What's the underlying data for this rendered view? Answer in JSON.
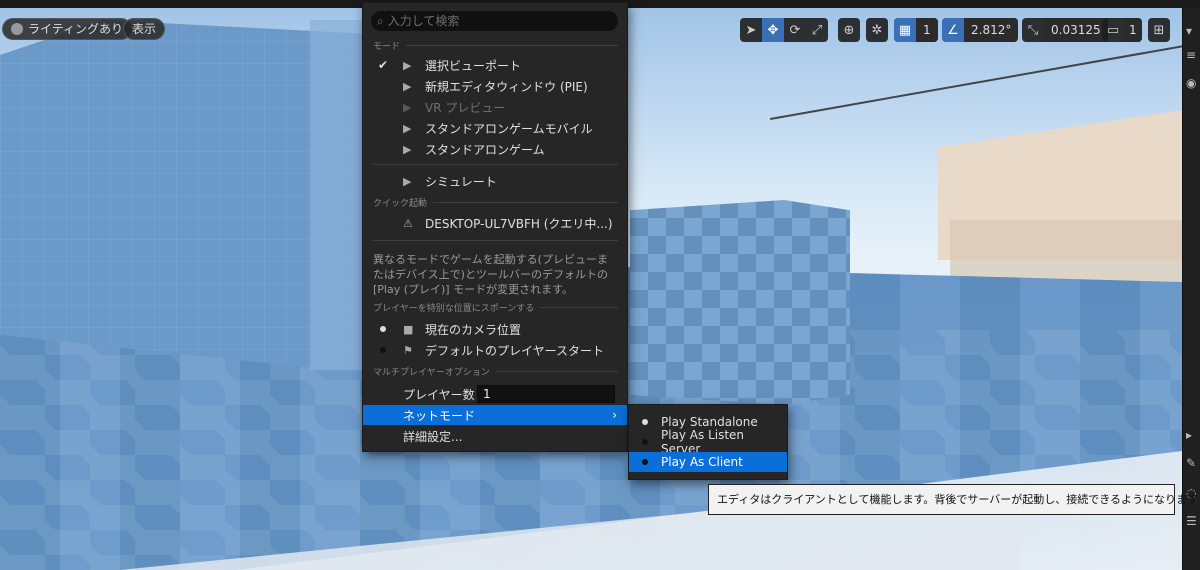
{
  "toolbar_left": {
    "lighting_label": "ライティングあり",
    "show_label": "表示"
  },
  "toolbar_right": {
    "grid_value": "1",
    "angle_value": "2.812°",
    "scale_value": "0.03125",
    "camera_value": "1"
  },
  "menu": {
    "search_placeholder": "入力して検索",
    "section_mode": "モード",
    "modes": [
      {
        "label": "選択ビューポート",
        "checked": true,
        "disabled": false
      },
      {
        "label": "新規エディタウィンドウ (PIE)",
        "checked": false,
        "disabled": false
      },
      {
        "label": "VR プレビュー",
        "checked": false,
        "disabled": true
      },
      {
        "label": "スタンドアロンゲームモバイル",
        "checked": false,
        "disabled": false
      },
      {
        "label": "スタンドアロンゲーム",
        "checked": false,
        "disabled": false
      }
    ],
    "simulate_label": "シミュレート",
    "section_quick": "クイック起動",
    "quick_device": "DESKTOP-UL7VBFH (クエリ中...)",
    "description": "異なるモードでゲームを起動する(プレビューまたはデバイス上で)とツールバーのデフォルトの[Play (プレイ)] モードが変更されます。",
    "section_spawn": "プレイヤーを特別な位置にスポーンする",
    "spawn_options": [
      {
        "label": "現在のカメラ位置",
        "selected": true
      },
      {
        "label": "デフォルトのプレイヤースタート",
        "selected": false
      }
    ],
    "section_multi": "マルチプレイヤーオプション",
    "player_count_label": "プレイヤー数",
    "player_count_value": "1",
    "net_mode_label": "ネットモード",
    "advanced_label": "詳細設定..."
  },
  "net_modes": [
    {
      "label": "Play Standalone",
      "selected": true
    },
    {
      "label": "Play As Listen Server",
      "selected": false
    },
    {
      "label": "Play As Client",
      "selected": false
    }
  ],
  "tooltip": "エディタはクライアントとして機能します。背後でサーバーが起動し、接続できるようになります"
}
